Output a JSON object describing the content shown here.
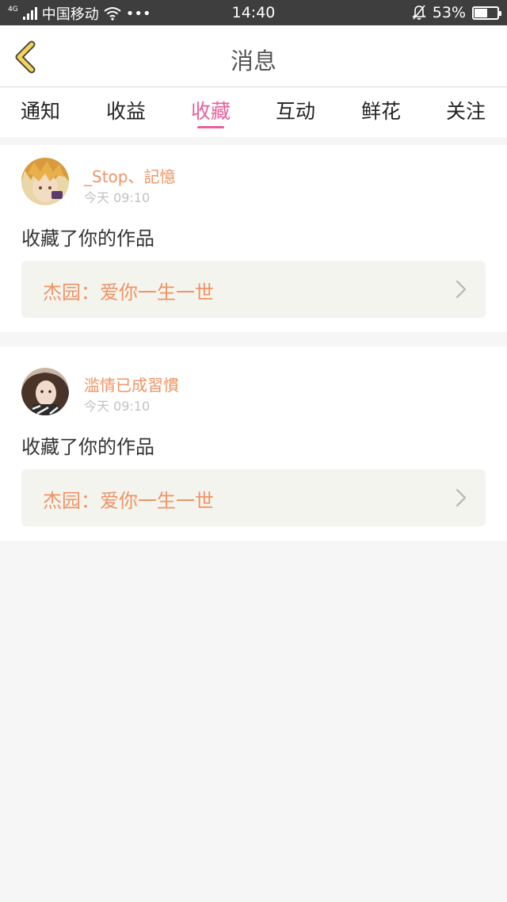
{
  "status_bar": {
    "network": "4G",
    "carrier": "中国移动",
    "more": "•••",
    "time": "14:40",
    "battery": "53%",
    "battery_level": 0.53
  },
  "header": {
    "back_icon": "chevron-left-icon",
    "title": "消息"
  },
  "tabs": [
    {
      "label": "通知",
      "active": false
    },
    {
      "label": "收益",
      "active": false
    },
    {
      "label": "收藏",
      "active": true
    },
    {
      "label": "互动",
      "active": false
    },
    {
      "label": "鲜花",
      "active": false
    },
    {
      "label": "关注",
      "active": false
    }
  ],
  "messages": [
    {
      "user": "_Stop、記憶",
      "time": "今天 09:10",
      "action": "收藏了你的作品",
      "work": "杰园：爱你一生一世"
    },
    {
      "user": "滥情已成習慣",
      "time": "今天 09:10",
      "action": "收藏了你的作品",
      "work": "杰园：爱你一生一世"
    }
  ],
  "colors": {
    "accent_pink": "#e8609b",
    "name_orange": "#ee9465",
    "back_yellow": "#f4d35c"
  }
}
